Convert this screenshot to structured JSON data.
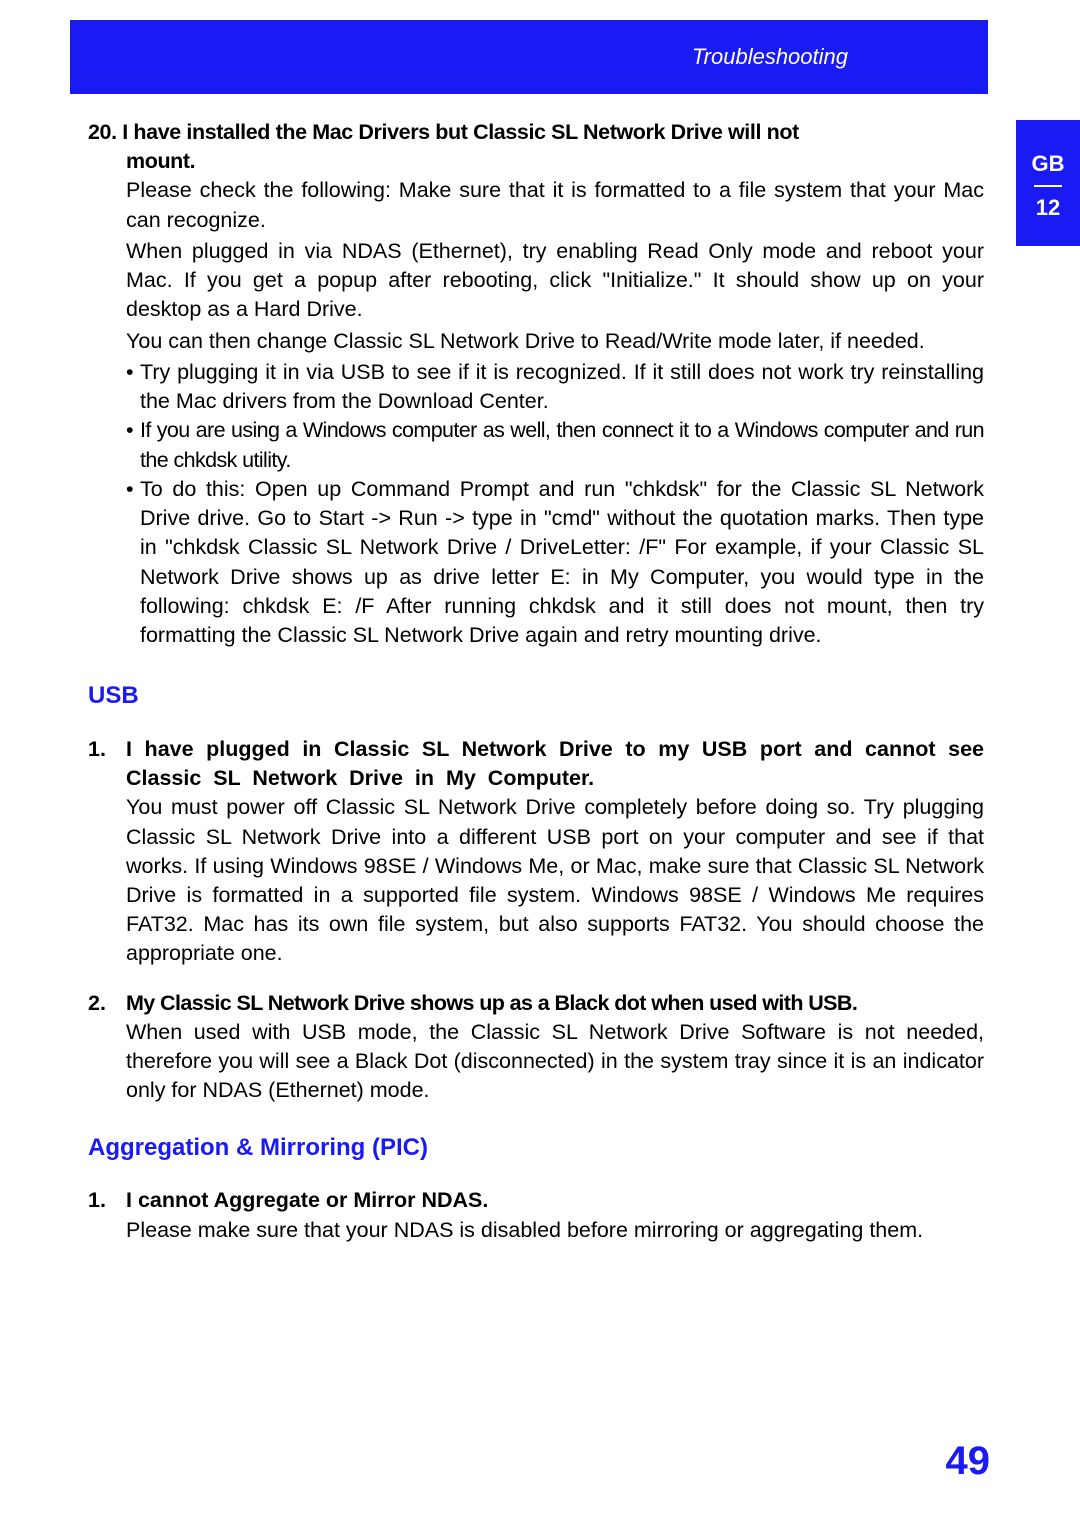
{
  "header": {
    "title": "Troubleshooting"
  },
  "sidetab": {
    "lang": "GB",
    "num": "12"
  },
  "page_number": "49",
  "sec20": {
    "num": "20.",
    "title_l1": "I have installed the Mac Drivers but Classic SL Network Drive will not",
    "title_l2": "mount.",
    "p1": "Please check the following: Make sure that it is formatted to a file system that your Mac can recognize.",
    "p2": "When plugged in via NDAS (Ethernet), try enabling Read Only mode and reboot your Mac. If you get a popup after rebooting, click \"Initialize.\" It should show up on your desktop as a Hard Drive.",
    "p3": "You can then change Classic SL Network Drive to Read/Write mode later, if needed.",
    "b1": "Try plugging it in via USB to see if it is recognized. If it still does not work try reinstalling the Mac drivers from the Download Center.",
    "b2": "If you are using a Windows computer as well, then connect it to a Windows computer and run the chkdsk utility.",
    "b3": "To do this: Open up Command Prompt and run \"chkdsk\" for the Classic SL Network Drive drive. Go to Start -> Run -> type in \"cmd\" without the quotation marks. Then type in \"chkdsk Classic SL Network Drive / DriveLetter: /F\" For example, if your Classic SL Network Drive shows up as drive letter E: in My Computer, you would type in the following: chkdsk E: /F After running chkdsk and it still does not mount, then try formatting the Classic SL Network Drive again and retry mounting drive."
  },
  "usb": {
    "heading": "USB",
    "q1": {
      "num": "1.",
      "title": "I have plugged in Classic SL Network Drive to my USB port and cannot see Classic SL Network Drive in My Computer.",
      "body": "You must power off Classic SL Network Drive completely before doing so. Try plugging Classic SL Network Drive into a different USB port on your computer and see if that works. If using Windows 98SE / Windows Me, or Mac, make sure that Classic SL Network Drive is formatted in a supported file system. Windows 98SE / Windows Me requires FAT32. Mac has its own file system, but also supports FAT32. You should choose the appropriate one."
    },
    "q2": {
      "num": "2.",
      "title": "My Classic SL Network Drive shows up as a Black dot when used with USB.",
      "body": "When used with USB mode, the Classic SL Network Drive Software is not needed, therefore you will see a Black Dot (disconnected) in the system tray since it is an indicator only for NDAS (Ethernet) mode."
    }
  },
  "agg": {
    "heading": "Aggregation & Mirroring (PIC)",
    "q1": {
      "num": "1.",
      "title": "I cannot Aggregate or Mirror NDAS.",
      "body": "Please make sure that your NDAS is disabled before mirroring or aggregating them."
    }
  }
}
